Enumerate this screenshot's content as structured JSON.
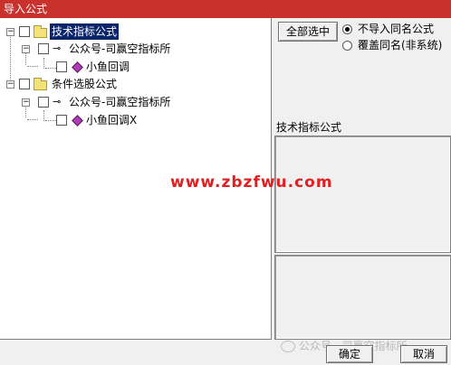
{
  "window": {
    "title": "导入公式"
  },
  "tree": {
    "groups": [
      {
        "label": "技术指标公式",
        "selected": true,
        "author": "公众号-司赢空指标所",
        "formula": "小鱼回调"
      },
      {
        "label": "条件选股公式",
        "selected": false,
        "author": "公众号-司赢空指标所",
        "formula": "小鱼回调X"
      }
    ]
  },
  "options": {
    "select_all_label": "全部选中",
    "radio_no_import": "不导入同名公式",
    "radio_overwrite": "覆盖同名(非系统)",
    "selected_radio": "no_import"
  },
  "info": {
    "section_label": "技术指标公式"
  },
  "watermark": {
    "text": "www.zbzfwu.com"
  },
  "footer": {
    "faint_text": "公众号 · 司赢空指标所",
    "ok_label": "确定",
    "cancel_label": "取消"
  },
  "colors": {
    "titlebar": "#c9322c",
    "selection": "#0a246a",
    "watermark": "#e02020"
  }
}
